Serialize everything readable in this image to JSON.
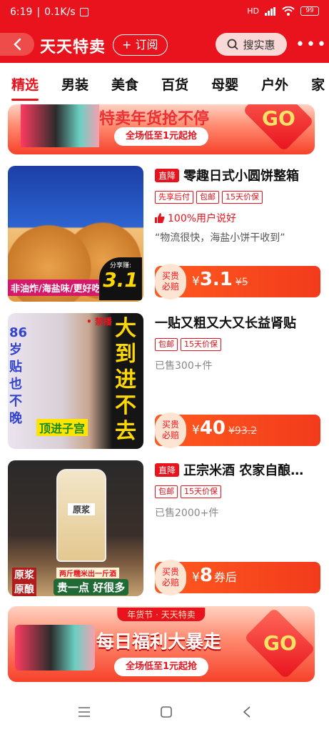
{
  "status_bar": {
    "time": "6:19",
    "speed": "0.1K/s",
    "signal": "HD",
    "battery": "99"
  },
  "header": {
    "logo": "天天特卖",
    "subscribe": "+ 订阅",
    "search": "搜实惠",
    "more": "•••"
  },
  "tabs": [
    "精选",
    "男装",
    "美食",
    "百货",
    "母婴",
    "户外",
    "家"
  ],
  "banner_top": {
    "headline": "特卖年货抢不停",
    "go": "GO",
    "sub": "全场低至1元起抢"
  },
  "products": [
    {
      "badge": "直降",
      "title": "零趣日式小圆饼整箱",
      "tags": [
        "先享后付",
        "包邮",
        "15天价保"
      ],
      "highlight": "100%用户说好",
      "quote": "“物流很快，海盐小饼干收到”",
      "thumb_text": "非油炸/海盐味/更好吃",
      "thumb_price_label": "分享赚:",
      "thumb_price": "3.1",
      "buy_label_1": "买贵",
      "buy_label_2": "必赔",
      "currency": "¥",
      "price": "3.1",
      "old_price": "¥5"
    },
    {
      "badge": "",
      "title": "一贴又粗又大又长益肾贴",
      "tags": [
        "包邮",
        "15天价保"
      ],
      "sold": "已售300+件",
      "thumb_banned": "• 禁播",
      "thumb_side_a": "86岁贴也不晚",
      "thumb_side_b": "大到进不去",
      "thumb_bottom": "顶进子宫",
      "buy_label_1": "买贵",
      "buy_label_2": "必赔",
      "currency": "¥",
      "price": "40",
      "old_price": "¥93.2"
    },
    {
      "badge": "直降",
      "title": "正宗米酒 农家自酿…",
      "tags": [
        "包邮",
        "15天价保"
      ],
      "sold": "已售2000+件",
      "thumb_label_a": "原浆",
      "thumb_label_b": "原酿",
      "thumb_slogan_1": "两斤糯米出一斤酒",
      "thumb_slogan_2": "贵一点 好很多",
      "jar_label": "原浆",
      "buy_label_1": "买贵",
      "buy_label_2": "必赔",
      "currency": "¥",
      "price": "8",
      "coupon": "券后"
    }
  ],
  "banner_bottom": {
    "ribbon": "年货节 · 天天特卖",
    "headline": "每日福利大暴走",
    "go": "GO",
    "sub": "全场低至1元起抢"
  },
  "colors": {
    "brand_red": "#e8131d",
    "orange": "#ff5a1f"
  },
  "icons": [
    "back-chevron-icon",
    "search-icon",
    "wifi-icon",
    "signal-icon",
    "battery-icon",
    "thumbs-up-icon",
    "menu-icon",
    "home-square-icon",
    "back-triangle-icon"
  ]
}
